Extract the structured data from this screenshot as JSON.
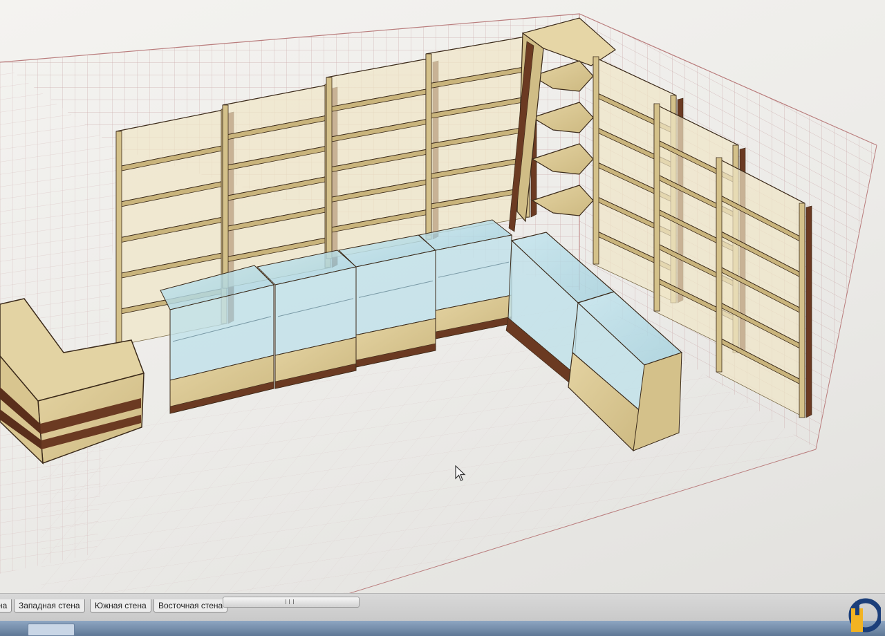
{
  "view": {
    "background": "#efeeeb",
    "grid_color": "#c9a4a4",
    "wood_color": "#dccb98",
    "trim_color": "#6b3a22",
    "glass_color": "#b9dde8"
  },
  "wall_tabs": [
    {
      "label": "на"
    },
    {
      "label": "Западная стена"
    },
    {
      "label": "Южная стена"
    },
    {
      "label": "Восточная стена"
    }
  ],
  "scrollbar": {
    "grip": "III"
  },
  "icons": {
    "cursor": "arrow-cursor-icon",
    "logo": "brand-logo-icon",
    "scroll_grip": "scroll-grip-icon"
  }
}
